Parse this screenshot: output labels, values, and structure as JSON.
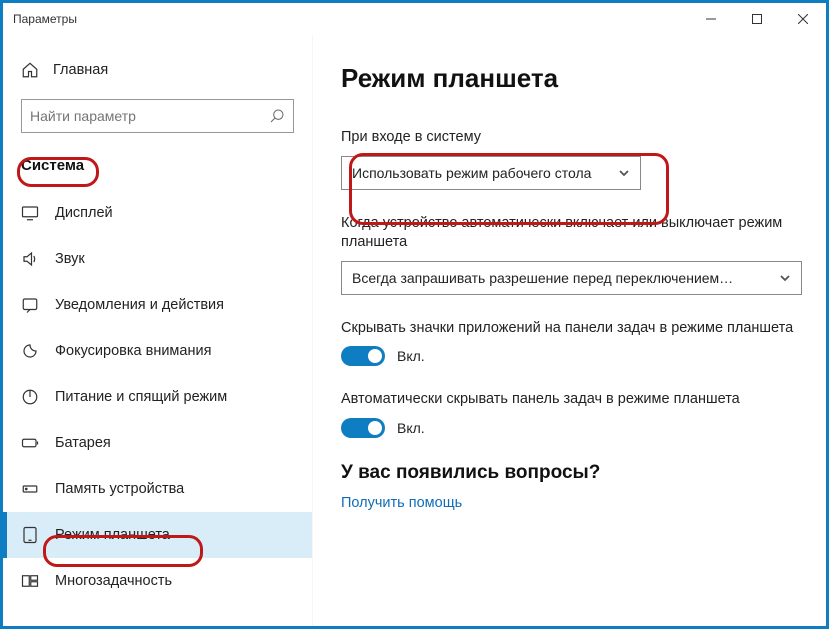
{
  "window": {
    "title": "Параметры"
  },
  "home": {
    "label": "Главная"
  },
  "search": {
    "placeholder": "Найти параметр"
  },
  "section": {
    "label": "Система"
  },
  "nav": [
    {
      "id": "display",
      "label": "Дисплей"
    },
    {
      "id": "sound",
      "label": "Звук"
    },
    {
      "id": "notifications",
      "label": "Уведомления и действия"
    },
    {
      "id": "focus",
      "label": "Фокусировка внимания"
    },
    {
      "id": "power",
      "label": "Питание и спящий режим"
    },
    {
      "id": "battery",
      "label": "Батарея"
    },
    {
      "id": "storage",
      "label": "Память устройства"
    },
    {
      "id": "tablet",
      "label": "Режим планшета",
      "active": true
    },
    {
      "id": "multitask",
      "label": "Многозадачность"
    }
  ],
  "page": {
    "title": "Режим планшета"
  },
  "settings": {
    "signin": {
      "label": "При входе в систему",
      "value": "Использовать режим рабочего стола"
    },
    "auto": {
      "label": "Когда устройство автоматически включает или выключает режим планшета",
      "value": "Всегда запрашивать разрешение перед переключением…"
    },
    "hideIcons": {
      "label": "Скрывать значки приложений на панели задач в режиме планшета",
      "state": "Вкл."
    },
    "hideTaskbar": {
      "label": "Автоматически скрывать панель задач в режиме планшета",
      "state": "Вкл."
    }
  },
  "help": {
    "title": "У вас появились вопросы?",
    "link": "Получить помощь"
  }
}
